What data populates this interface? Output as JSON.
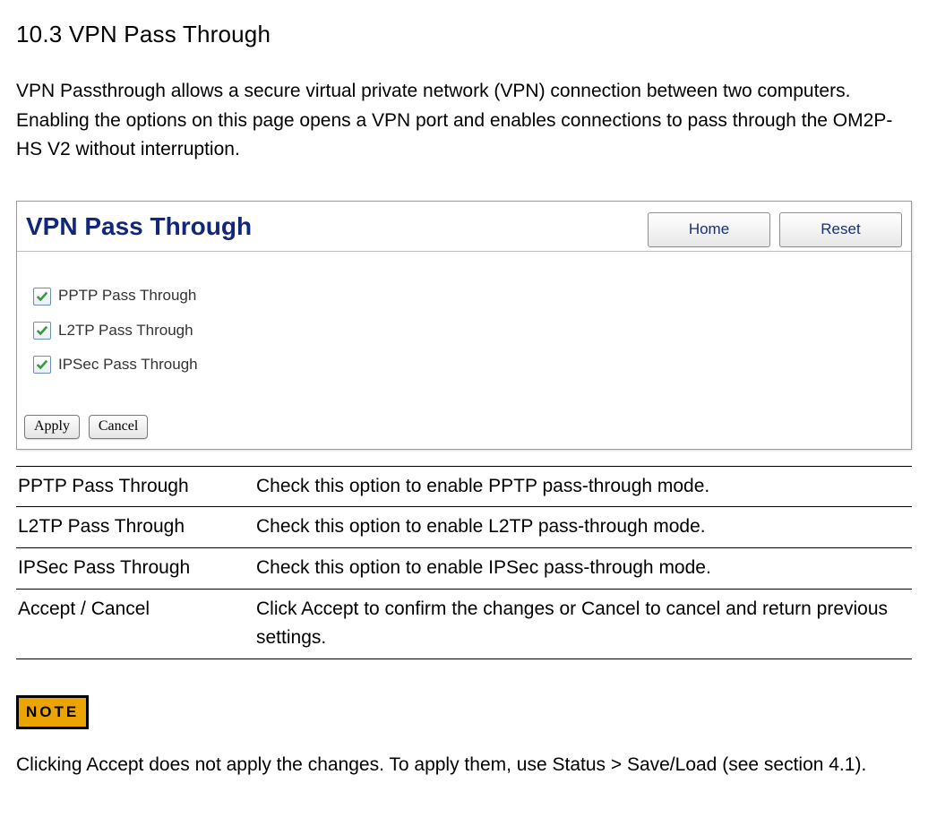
{
  "heading": "10.3 VPN Pass Through",
  "intro": "VPN Passthrough allows a secure virtual private network (VPN) connection between two computers. Enabling the options on this page opens a VPN port and enables connections to pass through the OM2P-HS V2 without interruption.",
  "panel": {
    "title": "VPN Pass Through",
    "home_label": "Home",
    "reset_label": "Reset",
    "options": [
      {
        "label": "PPTP Pass Through"
      },
      {
        "label": "L2TP Pass Through"
      },
      {
        "label": "IPSec Pass Through"
      }
    ],
    "apply_label": "Apply",
    "cancel_label": "Cancel"
  },
  "table": {
    "rows": [
      {
        "term": "PPTP Pass Through",
        "desc": "Check this option to enable PPTP pass-through mode."
      },
      {
        "term": "L2TP Pass Through",
        "desc": "Check this option to enable L2TP pass-through mode."
      },
      {
        "term": "IPSec Pass Through",
        "desc": "Check this option to enable IPSec pass-through mode."
      },
      {
        "term": "Accept / Cancel",
        "desc": "Click Accept to confirm the changes or Cancel to cancel and return previous settings."
      }
    ]
  },
  "note": {
    "badge": "NOTE",
    "text": "Clicking Accept does not apply the changes. To apply them, use Status > Save/Load (see section 4.1)."
  }
}
